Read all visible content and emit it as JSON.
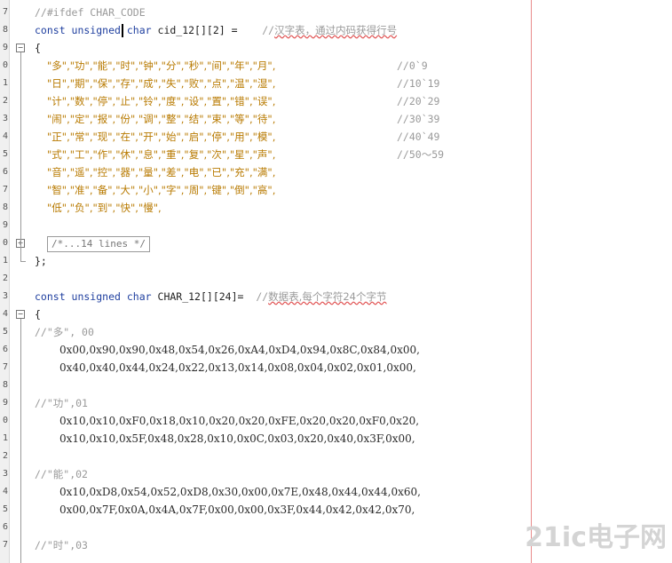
{
  "line_numbers": [
    "7",
    "8",
    "9",
    "0",
    "1",
    "2",
    "3",
    "4",
    "5",
    "6",
    "7",
    "8",
    "9",
    "0",
    "1",
    "2",
    "3",
    "4",
    "5",
    "6",
    "7",
    "8",
    "9",
    "0",
    "1",
    "2",
    "3",
    "4",
    "5",
    "6",
    "7",
    "8"
  ],
  "code": {
    "ifdef": "//#ifdef CHAR_CODE",
    "decl1_kw": "const unsigned",
    "decl1_type": "char",
    "decl1_name": "cid_12[][2] =",
    "decl1_comment_prefix": "//",
    "decl1_comment_text": "汉字表，通过内码获得行号",
    "open_brace": "{",
    "rows": [
      {
        "chars": "\"多\",\"功\",\"能\",\"时\",\"钟\",\"分\",\"秒\",\"间\",\"年\",\"月\",",
        "comment": "//0`9"
      },
      {
        "chars": "\"日\",\"期\",\"保\",\"存\",\"成\",\"失\",\"败\",\"点\",\"温\",\"湿\",",
        "comment": "//10`19"
      },
      {
        "chars": "\"计\",\"数\",\"停\",\"止\",\"铃\",\"度\",\"设\",\"置\",\"错\",\"误\",",
        "comment": "//20`29"
      },
      {
        "chars": "\"闹\",\"定\",\"报\",\"份\",\"调\",\"整\",\"结\",\"束\",\"等\",\"待\",",
        "comment": "//30`39"
      },
      {
        "chars": "\"正\",\"常\",\"现\",\"在\",\"开\",\"始\",\"启\",\"停\",\"用\",\"模\",",
        "comment": "//40`49"
      },
      {
        "chars": "\"式\",\"工\",\"作\",\"休\",\"息\",\"重\",\"复\",\"次\",\"星\",\"声\",",
        "comment": "//50～59"
      },
      {
        "chars": "\"音\",\"遥\",\"控\",\"器\",\"量\",\"差\",\"电\",\"已\",\"充\",\"满\",",
        "comment": ""
      },
      {
        "chars": "\"智\",\"准\",\"备\",\"大\",\"小\",\"字\",\"周\",\"键\",\"倒\",\"高\",",
        "comment": ""
      },
      {
        "chars": "\"低\",\"负\",\"到\",\"快\",\"慢\",",
        "comment": ""
      }
    ],
    "collapsed_text": "/*...14 lines */",
    "close_brace": "};",
    "decl2_kw": "const unsigned",
    "decl2_type": "char",
    "decl2_name": "CHAR_12[][24]=",
    "decl2_comment_prefix": "//",
    "decl2_comment_text": "数据表,每个字符24个字节",
    "glyphs": [
      {
        "label": "//\"多\", 00",
        "hex1": "0x00,0x90,0x90,0x48,0x54,0x26,0xA4,0xD4,0x94,0x8C,0x84,0x00,",
        "hex2": "0x40,0x40,0x44,0x24,0x22,0x13,0x14,0x08,0x04,0x02,0x01,0x00,"
      },
      {
        "label": "//\"功\",01",
        "hex1": "0x10,0x10,0xF0,0x18,0x10,0x20,0x20,0xFE,0x20,0x20,0xF0,0x20,",
        "hex2": "0x10,0x10,0x5F,0x48,0x28,0x10,0x0C,0x03,0x20,0x40,0x3F,0x00,"
      },
      {
        "label": "//\"能\",02",
        "hex1": "0x10,0xD8,0x54,0x52,0xD8,0x30,0x00,0x7E,0x48,0x44,0x44,0x60,",
        "hex2": "0x00,0x7F,0x0A,0x4A,0x7F,0x00,0x00,0x3F,0x44,0x42,0x42,0x70,"
      },
      {
        "label": "//\"时\",03",
        "hex1": "",
        "hex2": ""
      }
    ]
  },
  "watermark": "21ic电子网"
}
